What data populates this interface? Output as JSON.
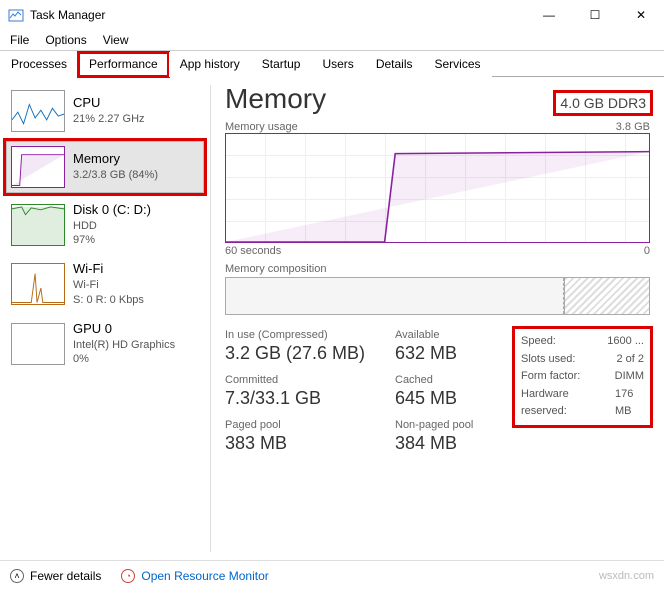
{
  "window": {
    "title": "Task Manager"
  },
  "menu": {
    "file": "File",
    "options": "Options",
    "view": "View"
  },
  "tabs": {
    "processes": "Processes",
    "performance": "Performance",
    "apphistory": "App history",
    "startup": "Startup",
    "users": "Users",
    "details": "Details",
    "services": "Services"
  },
  "sidebar": {
    "cpu": {
      "title": "CPU",
      "sub": "21%  2.27 GHz"
    },
    "memory": {
      "title": "Memory",
      "sub": "3.2/3.8 GB (84%)"
    },
    "disk": {
      "title": "Disk 0 (C: D:)",
      "sub": "HDD",
      "sub2": "97%"
    },
    "wifi": {
      "title": "Wi-Fi",
      "sub": "Wi-Fi",
      "sub2": "S: 0 R: 0 Kbps"
    },
    "gpu": {
      "title": "GPU 0",
      "sub": "Intel(R) HD Graphics",
      "sub2": "0%"
    }
  },
  "main": {
    "title": "Memory",
    "capacity": "4.0 GB DDR3",
    "usage_label": "Memory usage",
    "usage_max": "3.8 GB",
    "axis_left": "60 seconds",
    "axis_right": "0",
    "composition_label": "Memory composition",
    "stats": {
      "inuse_label": "In use (Compressed)",
      "inuse_value": "3.2 GB (27.6 MB)",
      "available_label": "Available",
      "available_value": "632 MB",
      "committed_label": "Committed",
      "committed_value": "7.3/33.1 GB",
      "cached_label": "Cached",
      "cached_value": "645 MB",
      "paged_label": "Paged pool",
      "paged_value": "383 MB",
      "nonpaged_label": "Non-paged pool",
      "nonpaged_value": "384 MB"
    },
    "kv": {
      "speed_label": "Speed:",
      "speed_value": "1600 ...",
      "slots_label": "Slots used:",
      "slots_value": "2 of 2",
      "form_label": "Form factor:",
      "form_value": "DIMM",
      "hwres_label": "Hardware reserved:",
      "hwres_value": "176 MB"
    }
  },
  "footer": {
    "fewer": "Fewer details",
    "orm": "Open Resource Monitor"
  },
  "watermark": "wsxdn.com",
  "chart_data": {
    "type": "line",
    "title": "Memory usage",
    "xlabel": "seconds ago",
    "ylabel": "GB",
    "xlim": [
      60,
      0
    ],
    "ylim": [
      0,
      3.8
    ],
    "x": [
      60,
      55,
      50,
      45,
      40,
      38,
      36,
      35,
      30,
      25,
      20,
      15,
      10,
      5,
      0
    ],
    "values": [
      0,
      0,
      0,
      0,
      0,
      0.1,
      2.5,
      3.2,
      3.25,
      3.2,
      3.25,
      3.15,
      3.2,
      3.2,
      3.2
    ]
  }
}
